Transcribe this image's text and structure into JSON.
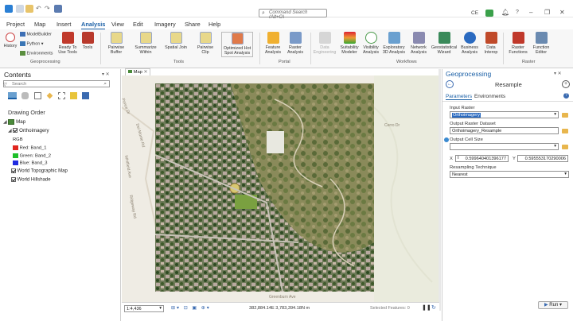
{
  "titlebar": {
    "search_placeholder": "Command Search (Alt+Q)",
    "user_initials": "CE",
    "window_controls": [
      "?",
      "–",
      "❐",
      "✕"
    ]
  },
  "menu": {
    "tabs": [
      "Project",
      "Map",
      "Insert",
      "Analysis",
      "View",
      "Edit",
      "Imagery",
      "Share",
      "Help"
    ],
    "active": "Analysis"
  },
  "ribbon": {
    "geoprocessing": {
      "history": "History",
      "modelbuilder": "ModelBuilder",
      "python": "Python",
      "environments": "Environments",
      "ready_tools": "Ready To Use Tools",
      "tools": "Tools",
      "group": "Geoprocessing"
    },
    "tools": {
      "items": [
        "Pairwise Buffer",
        "Summarize Within",
        "Spatial Join",
        "Pairwise Clip",
        "Optimized Hot Spot Analysis"
      ],
      "group": "Tools"
    },
    "portal": {
      "items": [
        "Feature Analysis",
        "Raster Analysis"
      ],
      "group": "Portal"
    },
    "workflows": {
      "items": [
        "Data Engineering",
        "Suitability Modeler",
        "Visibility Analysis",
        "Exploratory 3D Analysis",
        "Network Analysis",
        "Geostatistical Wizard",
        "Business Analysis",
        "Data Interop"
      ],
      "group": "Workflows"
    },
    "raster": {
      "items": [
        "Raster Functions",
        "Function Editor"
      ],
      "group": "Raster"
    }
  },
  "contents": {
    "title": "Contents",
    "search_placeholder": "Search",
    "drawing_order": "Drawing Order",
    "map_label": "Map",
    "layers": {
      "ortho": "Orthoimagery",
      "rgb": "RGB",
      "red": "Red:  Band_1",
      "green": "Green: Band_2",
      "blue": "Blue:  Band_3",
      "topo": "World Topographic Map",
      "hillshade": "World Hillshade"
    },
    "colors": {
      "red": "#e0261f",
      "green": "#1fbf2a",
      "blue": "#1f2be0"
    }
  },
  "mapview": {
    "tab_label": "Map",
    "scale": "1:4,436",
    "coords": "382,884.14E 3,783,394.18N m",
    "selected": "Selected Features: 0",
    "street_labels": [
      "Ponce Dr",
      "Del Monte Rd",
      "Ridgeway Rd",
      "Whitfield Ave",
      "Cerro Dr",
      "Greenburn Ave"
    ]
  },
  "geoprocessing": {
    "title": "Geoprocessing",
    "tool_name": "Resample",
    "tabs": [
      "Parameters",
      "Environments"
    ],
    "input_raster_label": "Input Raster",
    "input_raster_value": "Orthoimagery",
    "output_label": "Output Raster Dataset",
    "output_value": "Orthoimagery_Resample",
    "cell_size_label": "Output Cell Size",
    "x_label": "X",
    "x_value": "0.599640401396177",
    "y_label": "Y",
    "y_value": "0.595553170290006",
    "technique_label": "Resampling Technique",
    "technique_value": "Nearest",
    "run_label": "Run"
  }
}
